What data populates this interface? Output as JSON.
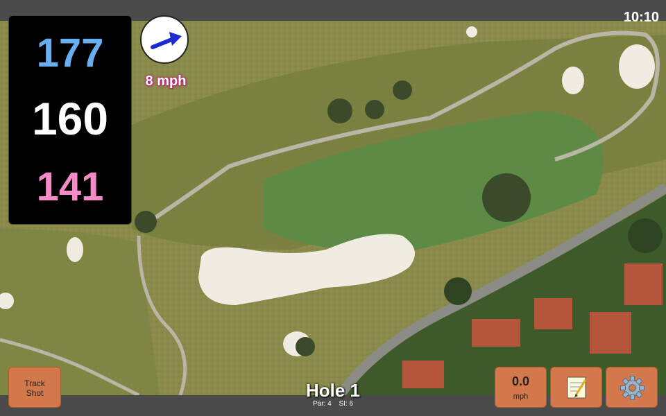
{
  "status": {
    "time": "10:10"
  },
  "distances": {
    "back": "177",
    "center": "160",
    "front": "141"
  },
  "wind": {
    "speed_label": "8 mph",
    "direction": "east-northeast"
  },
  "hole": {
    "title": "Hole 1",
    "par_label": "Par: 4",
    "si_label": "SI: 6"
  },
  "buttons": {
    "track_shot_line1": "Track",
    "track_shot_line2": "Shot",
    "wind_value": "0.0",
    "wind_unit": "mph",
    "notes_icon": "notepad-icon",
    "settings_icon": "gear-icon"
  },
  "colors": {
    "back_distance": "#6aaef2",
    "center_distance": "#ffffff",
    "front_distance": "#f48bc8",
    "button": "#d2784a",
    "wind_arrow": "#1a2ccf"
  }
}
